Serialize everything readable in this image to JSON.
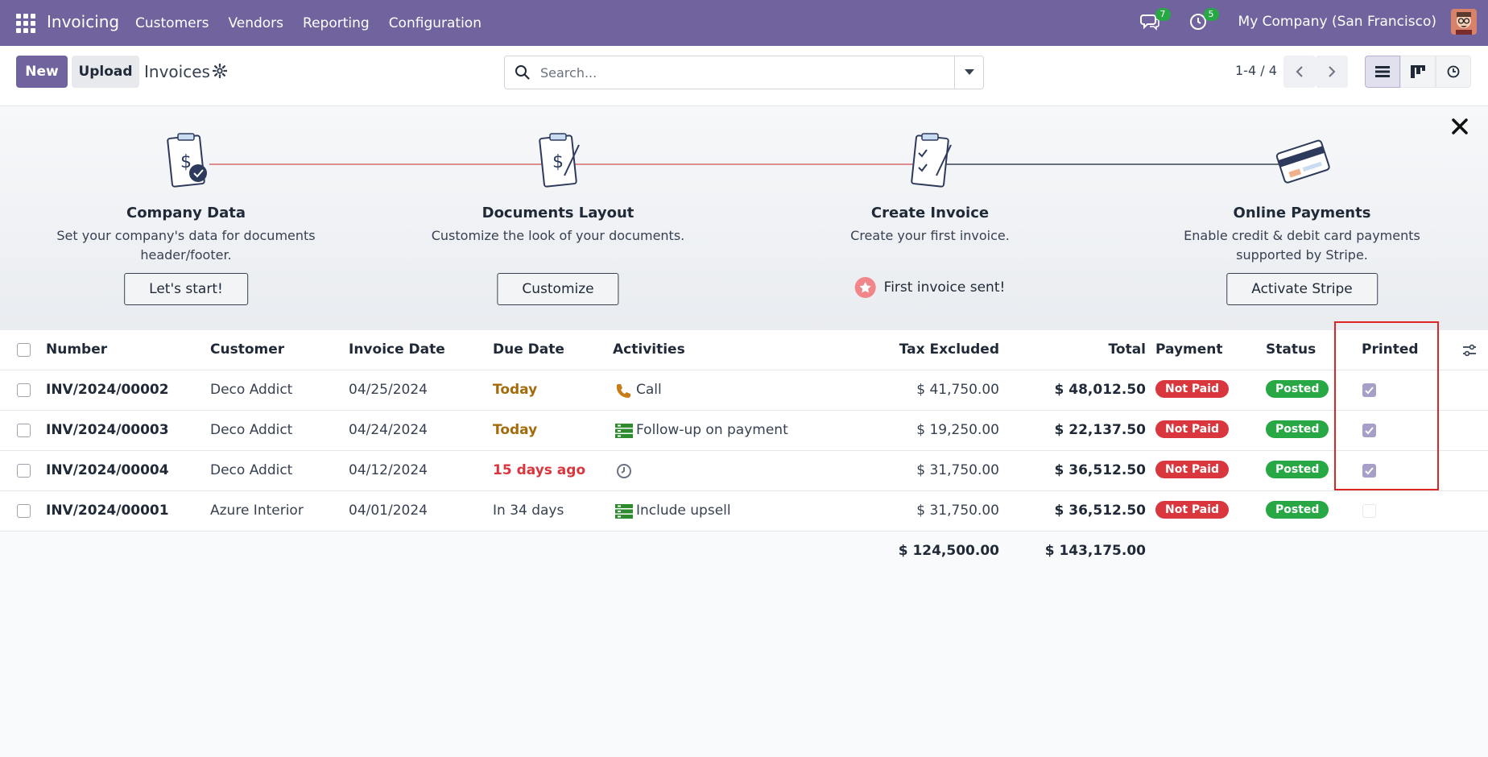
{
  "navbar": {
    "brand": "Invoicing",
    "menu": [
      "Customers",
      "Vendors",
      "Reporting",
      "Configuration"
    ],
    "messages_count": "7",
    "activities_count": "5",
    "company": "My Company (San Francisco)"
  },
  "control": {
    "new_label": "New",
    "upload_label": "Upload",
    "breadcrumb": "Invoices",
    "search_placeholder": "Search...",
    "pager": "1-4 / 4"
  },
  "onboarding": {
    "steps": [
      {
        "title": "Company Data",
        "desc": "Set your company's data for documents header/footer.",
        "button": "Let's start!"
      },
      {
        "title": "Documents Layout",
        "desc": "Customize the look of your documents.",
        "button": "Customize"
      },
      {
        "title": "Create Invoice",
        "desc": "Create your first invoice.",
        "done": "First invoice sent!"
      },
      {
        "title": "Online Payments",
        "desc": "Enable credit & debit card payments supported by Stripe.",
        "button": "Activate Stripe"
      }
    ]
  },
  "table": {
    "headers": {
      "number": "Number",
      "customer": "Customer",
      "invoice_date": "Invoice Date",
      "due_date": "Due Date",
      "activities": "Activities",
      "tax_excluded": "Tax Excluded",
      "total": "Total",
      "payment": "Payment",
      "status": "Status",
      "printed": "Printed"
    },
    "rows": [
      {
        "number": "INV/2024/00002",
        "customer": "Deco Addict",
        "invoice_date": "04/25/2024",
        "due_date": "Today",
        "activity": "Call",
        "tax_excluded": "$ 41,750.00",
        "total": "$ 48,012.50",
        "payment": "Not Paid",
        "status": "Posted"
      },
      {
        "number": "INV/2024/00003",
        "customer": "Deco Addict",
        "invoice_date": "04/24/2024",
        "due_date": "Today",
        "activity": "Follow-up on payment",
        "tax_excluded": "$ 19,250.00",
        "total": "$ 22,137.50",
        "payment": "Not Paid",
        "status": "Posted"
      },
      {
        "number": "INV/2024/00004",
        "customer": "Deco Addict",
        "invoice_date": "04/12/2024",
        "due_date": "15 days ago",
        "activity": "",
        "tax_excluded": "$ 31,750.00",
        "total": "$ 36,512.50",
        "payment": "Not Paid",
        "status": "Posted"
      },
      {
        "number": "INV/2024/00001",
        "customer": "Azure Interior",
        "invoice_date": "04/01/2024",
        "due_date": "In 34 days",
        "activity": "Include upsell",
        "tax_excluded": "$ 31,750.00",
        "total": "$ 36,512.50",
        "payment": "Not Paid",
        "status": "Posted"
      }
    ],
    "totals": {
      "tax_excluded": "$ 124,500.00",
      "total": "$ 143,175.00"
    }
  },
  "colors": {
    "brand": "#71639e",
    "not_paid": "#d9363e",
    "posted": "#28a745",
    "highlight": "#e02424"
  }
}
